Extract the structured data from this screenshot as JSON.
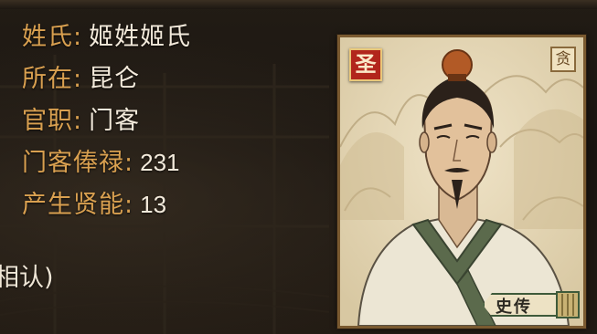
{
  "info": {
    "rows": [
      {
        "label": "姓氏",
        "colon": ":",
        "value": "姬姓姬氏"
      },
      {
        "label": "所在",
        "colon": ":",
        "value": "昆仑"
      },
      {
        "label": "官职",
        "colon": ":",
        "value": "门客"
      },
      {
        "label": "门客俸禄",
        "colon": ":",
        "value": "231"
      },
      {
        "label": "产生贤能",
        "colon": ":",
        "value": "13"
      }
    ]
  },
  "partial_text": "相认)",
  "card": {
    "badge_sage": "圣",
    "badge_greed": "贪",
    "history_button": "史传"
  },
  "colors": {
    "label": "#d9a050",
    "value": "#f3eadb",
    "sage_badge": "#b2261c",
    "card_frame": "#7a5a30"
  },
  "icons": [
    "sage-badge-icon",
    "greed-badge-icon",
    "bamboo-book-icon"
  ]
}
